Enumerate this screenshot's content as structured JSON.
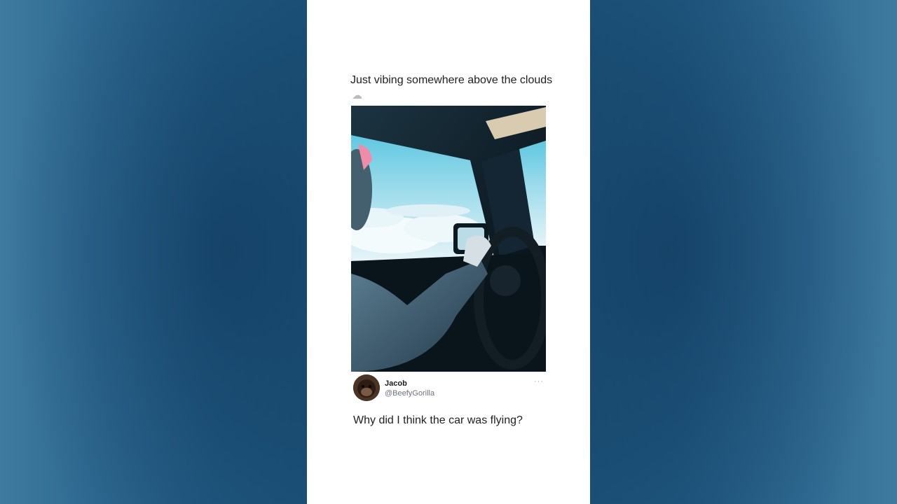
{
  "post": {
    "text": "Just vibing somewhere above the clouds",
    "emoji": "☁"
  },
  "media": {
    "alt_subject": "driver-above-clouds"
  },
  "reply": {
    "name": "Jacob",
    "handle": "@BeefyGorilla",
    "more_label": "···",
    "text": "Why did I think the car was flying?"
  },
  "colors": {
    "background_blue": "#2a6690",
    "card": "#ffffff",
    "text": "#1f1f1f",
    "muted": "#6b7280"
  }
}
